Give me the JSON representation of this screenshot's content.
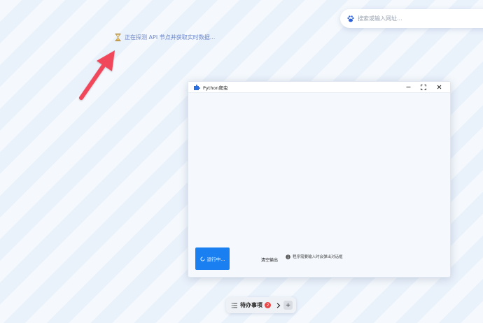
{
  "search": {
    "placeholder": "搜索或输入网址..."
  },
  "status": {
    "text": "正在探测 API 节点并获取实时数据..."
  },
  "window": {
    "title": "Python爬虫",
    "controls": {
      "minimize": "–",
      "maximize": "⛶",
      "close": "×"
    },
    "run_button_label": "运行中...",
    "clear_output_label": "清空输出",
    "hint_text": "程序需要输入时会弹出对话框"
  },
  "taskbar": {
    "todo_label": "待办事项",
    "badge_count": "2",
    "plus_label": "+"
  },
  "colors": {
    "accent": "#1a7ff0",
    "status_text": "#6b86c9",
    "arrow": "#f0475a",
    "badge": "#e84848"
  },
  "icons": [
    "paw-icon",
    "hourglass-icon",
    "red-arrow-icon",
    "app-puzzle-icon",
    "spinner-icon",
    "info-icon",
    "list-icon",
    "chevron-right-icon",
    "plus-icon"
  ]
}
